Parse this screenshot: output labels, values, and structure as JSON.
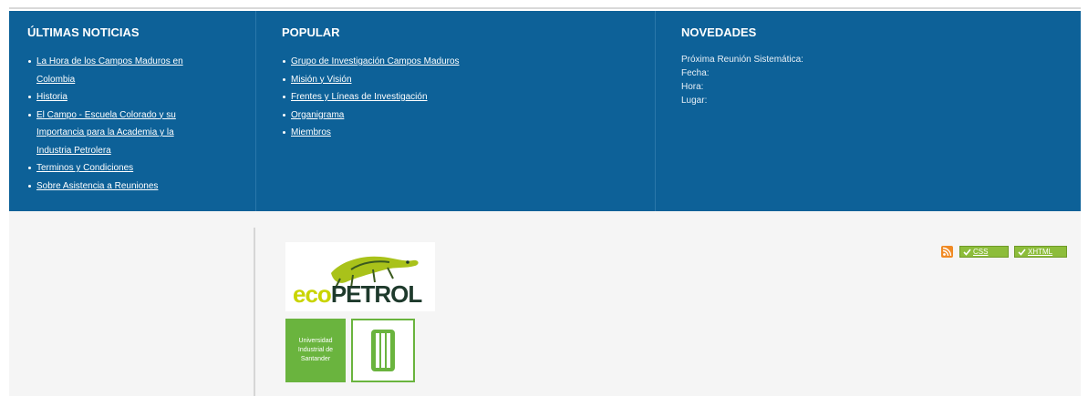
{
  "columns": {
    "ultimas": {
      "title": "ÚLTIMAS NOTICIAS",
      "items": [
        [
          "La Hora de los Campos Maduros en",
          "Colombia"
        ],
        [
          "Historia"
        ],
        [
          "El Campo - Escuela Colorado y su",
          "Importancia para la Academia y la",
          "Industria Petrolera"
        ],
        [
          "Terminos y Condiciones"
        ],
        [
          "Sobre Asistencia a Reuniones"
        ]
      ]
    },
    "popular": {
      "title": "POPULAR",
      "items": [
        "Grupo de Investigación Campos Maduros",
        "Misión y Visión",
        "Frentes y Líneas de Investigación",
        "Organigrama",
        "Miembros"
      ]
    },
    "novedades": {
      "title": "NOVEDADES",
      "lines": [
        "Próxima Reunión Sistemática:",
        "Fecha:",
        "Hora:",
        "Lugar:"
      ]
    }
  },
  "logos": {
    "ecopetrol": {
      "text_green": "eco",
      "text_dark": "PETROL"
    },
    "uis": {
      "lines": [
        "Universidad",
        "Industrial de",
        "Santander"
      ]
    }
  },
  "badges": {
    "css": "CSS",
    "xhtml": "XHTML"
  },
  "colors": {
    "footer_blue": "#0d6198",
    "accent_green": "#6ab43e",
    "rss_orange": "#f08a24"
  },
  "icons": [
    "rss-icon",
    "check-icon",
    "iguana-icon",
    "uis-emblem-icon"
  ]
}
